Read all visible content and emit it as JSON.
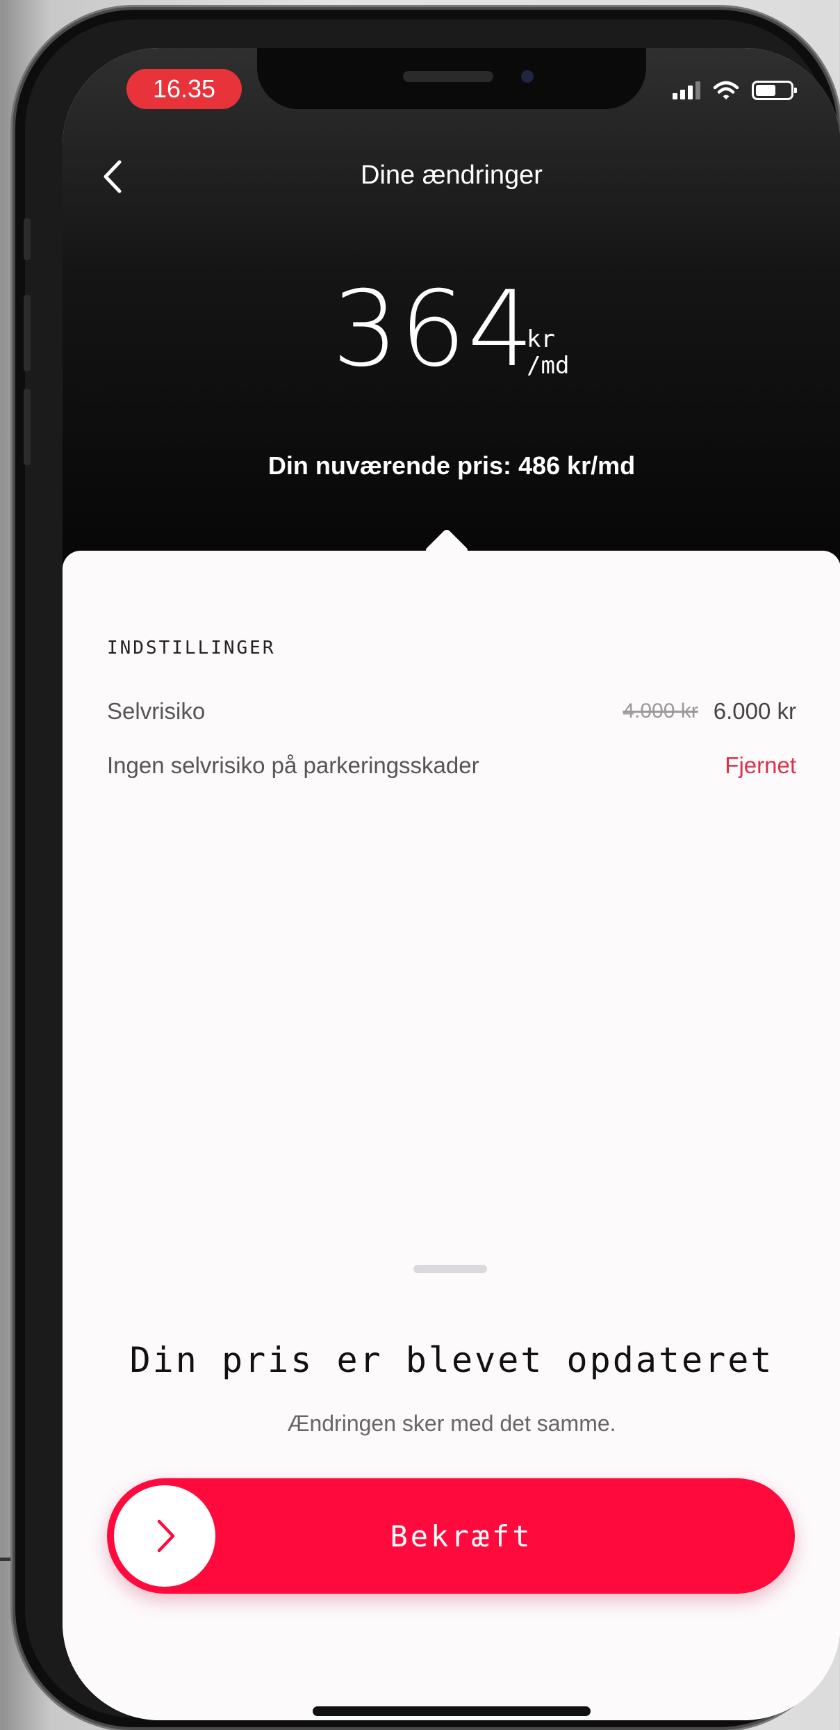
{
  "status_bar": {
    "time": "16.35"
  },
  "header": {
    "title": "Dine ændringer",
    "price_value": "364",
    "price_unit_top": "kr",
    "price_unit_bottom": "/md",
    "current_price": "Din nuværende pris: 486 kr/md"
  },
  "settings": {
    "section_title": "INDSTILLINGER",
    "rows": [
      {
        "label": "Selvrisiko",
        "old_value": "4.000 kr",
        "new_value": "6.000 kr"
      },
      {
        "label": "Ingen selvrisiko på parkeringsskader",
        "status": "Fjernet"
      }
    ]
  },
  "confirmation": {
    "headline": "Din pris er blevet opdateret",
    "subline": "Ændringen sker med det samme.",
    "button_label": "Bekræft"
  },
  "colors": {
    "accent": "#ff0a3c",
    "removed": "#d8334a",
    "time_pill": "#e8333a"
  }
}
